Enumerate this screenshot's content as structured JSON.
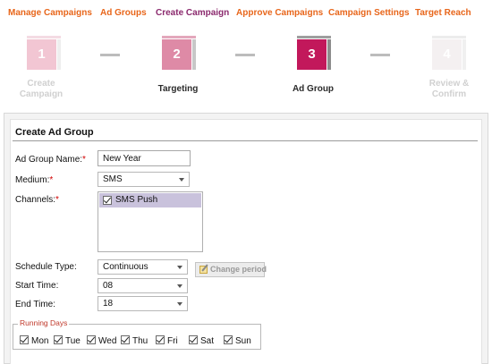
{
  "nav": {
    "items": [
      {
        "label": "Manage Campaigns",
        "active": false
      },
      {
        "label": "Ad Groups",
        "active": false
      },
      {
        "label": "Create Campaign",
        "active": true
      },
      {
        "label": "Approve Campaigns",
        "active": false
      },
      {
        "label": "Campaign Settings",
        "active": false
      },
      {
        "label": "Target Reach",
        "active": false
      }
    ]
  },
  "steps": [
    {
      "number": "1",
      "label_line1": "Create",
      "label_line2": "Campaign",
      "state": "done"
    },
    {
      "number": "2",
      "label_line1": "Targeting",
      "label_line2": "",
      "state": "done-visible"
    },
    {
      "number": "3",
      "label_line1": "Ad Group",
      "label_line2": "",
      "state": "current"
    },
    {
      "number": "4",
      "label_line1": "Review &",
      "label_line2": "Confirm",
      "state": "upcoming"
    }
  ],
  "form": {
    "title": "Create Ad Group",
    "ad_group_name": {
      "label": "Ad Group Name:",
      "required_mark": "*",
      "value": "New Year"
    },
    "medium": {
      "label": "Medium:",
      "required_mark": "*",
      "value": "SMS"
    },
    "channels": {
      "label": "Channels:",
      "required_mark": "*",
      "options": [
        {
          "label": "SMS Push",
          "checked": true
        }
      ]
    },
    "schedule_type": {
      "label": "Schedule Type:",
      "value": "Continuous",
      "change_button": "Change period"
    },
    "start_time": {
      "label": "Start Time:",
      "value": "08"
    },
    "end_time": {
      "label": "End Time:",
      "value": "18"
    },
    "running_days": {
      "legend": "Running Days",
      "days": [
        {
          "label": "Mon",
          "checked": true
        },
        {
          "label": "Tue",
          "checked": true
        },
        {
          "label": "Wed",
          "checked": true
        },
        {
          "label": "Thu",
          "checked": true
        },
        {
          "label": "Fri",
          "checked": true
        },
        {
          "label": "Sat",
          "checked": true
        },
        {
          "label": "Sun",
          "checked": true
        }
      ]
    }
  },
  "colors": {
    "nav_link": "#e8661b",
    "nav_active": "#8b2a6e",
    "step_faded": "#f2c6d3",
    "step_mid": "#de8aa6",
    "step_current": "#c2185b",
    "required": "#d00000"
  },
  "icons": {
    "checkbox": "check-icon",
    "select_caret": "chevron-down-icon",
    "change_period": "edit-icon"
  }
}
